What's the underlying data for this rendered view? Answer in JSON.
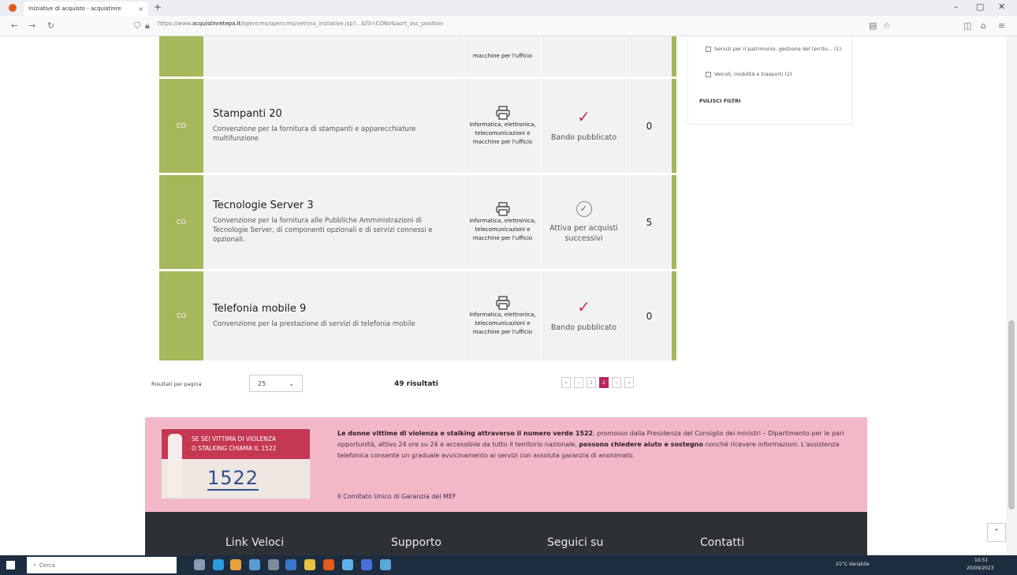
{
  "browser": {
    "tab_title": "Iniziative di acquisto - acquistinre",
    "tab_close": "×",
    "new_tab": "+",
    "url_prefix": "https://www.",
    "url_domain": "acquistinretepa.it",
    "url_path": "/opencms/opencms/vetrina_iniziative.jsp?...&f3=CONV&sort_asc_position",
    "win_min": "–",
    "win_max": "▢",
    "win_close": "✕"
  },
  "rows": [
    {
      "badge": "CO",
      "category_text": "macchine per l'ufficio",
      "number": ""
    },
    {
      "badge": "CO",
      "name": "Stampanti 20",
      "description": "Convenzione per la fornitura di stampanti e apparecchiature multifunzione",
      "category_icon": "printer-icon",
      "category_text": "Informatica, elettronica, telecomunicazioni e macchine per l'ufficio",
      "state_icon": "check-icon",
      "state_text": "Bando pubblicato",
      "number": "0"
    },
    {
      "badge": "CO",
      "name": "Tecnologie Server 3",
      "description": "Convenzione per la fornitura alle Pubbliche Amministrazioni di Tecnologie Server, di componenti opzionali e di servizi connessi e opzionali.",
      "category_icon": "printer-icon",
      "category_text": "Informatica, elettronica, telecomunicazioni e macchine per l'ufficio",
      "state_icon": "check-circle-icon",
      "state_text": "Attiva per acquisti successivi",
      "number": "5"
    },
    {
      "badge": "CO",
      "name": "Telefonia mobile 9",
      "description": "Convenzione per la prestazione di servizi di telefonia mobile",
      "category_icon": "printer-icon",
      "category_text": "Informatica, elettronica, telecomunicazioni e macchine per l'ufficio",
      "state_icon": "check-icon",
      "state_text": "Bando pubblicato",
      "number": "0"
    }
  ],
  "filters": {
    "items": [
      "Servizi per il patrimonio, gestione del territo... (1)",
      "Veicoli, mobilità e trasporti (2)"
    ],
    "reset": "PULISCI FILTRI"
  },
  "pagination": {
    "per_page_label": "Risultati per pagina",
    "per_page_value": "25",
    "results": "49 risultati",
    "pages": [
      "«",
      "‹",
      "1",
      "2",
      "›",
      "»"
    ],
    "active_page": "2"
  },
  "banner": {
    "logo_line1": "SE SEI VITTIMA DI VIOLENZA",
    "logo_line2": "O STALKING CHIAMA IL 1522",
    "logo_number": "1522",
    "text_bold1": "Le donne vittime di violenza e stalking attraverso il numero verde 1522",
    "text_part1": ", promosso dalla Presidenza del Consiglio dei ministri – Dipartimento per le pari opportunità, attivo 24 ore su 24 e accessibile da tutto il territorio nazionale, ",
    "text_bold2": "possono chiedere aiuto e sostegno",
    "text_part2": " nonché ricevere informazioni. L'assistenza telefonica consente un graduale avvicinamento ai servizi con assoluta garanzia di anonimato.",
    "link": "Il Comitato Unico di Garanzia del MEF"
  },
  "footer": {
    "col1": "Link Veloci",
    "col2": "Supporto",
    "col3": "Seguici su",
    "col4": "Contatti"
  },
  "scroll_top": "⌃",
  "taskbar": {
    "search": "Cerca",
    "weather": "21°C Variabile",
    "time": "10:51",
    "date": "20/09/2023"
  }
}
